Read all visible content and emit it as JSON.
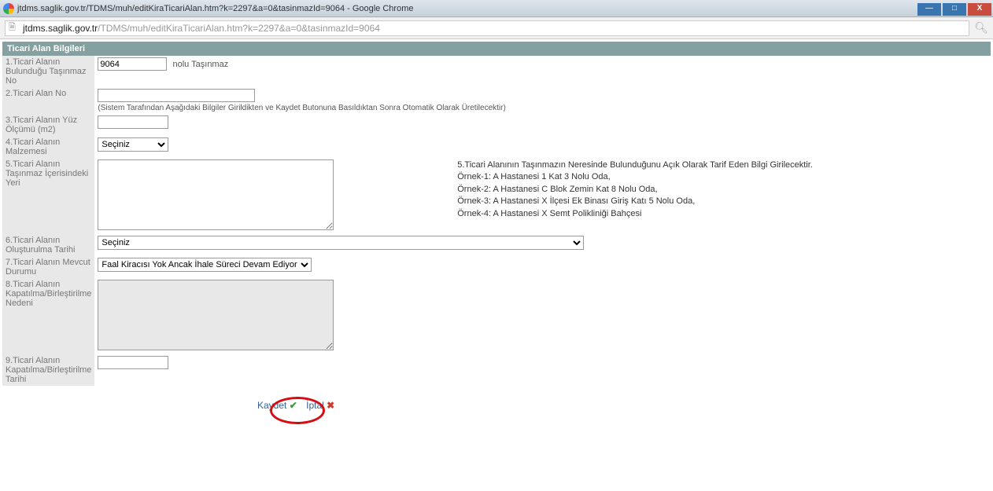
{
  "window": {
    "title": "jtdms.saglik.gov.tr/TDMS/muh/editKiraTicariAlan.htm?k=2297&a=0&tasinmazId=9064 - Google Chrome"
  },
  "url": {
    "domain": "jtdms.saglik.gov.tr",
    "path": "/TDMS/muh/editKiraTicariAlan.htm?k=2297&a=0&tasinmazId=9064"
  },
  "section_header": "Ticari Alan Bilgileri",
  "labels": {
    "r1": "1.Ticari Alanın Bulunduğu Taşınmaz No",
    "r2": "2.Ticari Alan No",
    "r3": "3.Ticari Alanın Yüz Ölçümü (m2)",
    "r4": "4.Ticari Alanın Malzemesi",
    "r5": "5.Ticari Alanın Taşınmaz İçerisindeki Yeri",
    "r6": "6.Ticari Alanın Oluşturulma Tarihi",
    "r7": "7.Ticari Alanın Mevcut Durumu",
    "r8": "8.Ticari Alanın Kapatılma/Birleştirilme Nedeni",
    "r9": "9.Ticari Alanın Kapatılma/Birleştirilme Tarihi"
  },
  "values": {
    "tasinmaz_no": "9064",
    "tasinmaz_suffix": "nolu Taşınmaz",
    "ticari_alan_no": "",
    "ticari_alan_hint": "(Sistem Tarafından Aşağıdaki Bilgiler Girildikten ve Kaydet Butonuna Basıldıktan Sonra Otomatik Olarak Üretilecektir)",
    "yuzolcum": "",
    "malzeme_selected": "Seçiniz",
    "yeri_text": "",
    "olusturma_selected": "Seçiniz",
    "mevcut_durum_selected": "Faal Kiracısı Yok Ancak İhale Süreci Devam Ediyor",
    "kapatma_nedeni": "",
    "kapatma_tarihi": ""
  },
  "info_block": {
    "line1": "5.Ticari Alanının Taşınmazın Neresinde Bulunduğunu Açık Olarak Tarif Eden Bilgi Girilecektir.",
    "line2": "Örnek-1: A Hastanesi 1 Kat 3 Nolu Oda,",
    "line3": "Örnek-2: A Hastanesi C Blok Zemin Kat 8 Nolu Oda,",
    "line4": "Örnek-3: A Hastanesi X İlçesi Ek Binası Giriş Katı 5 Nolu Oda,",
    "line5": "Örnek-4: A Hastanesi X Semt Polikliniği Bahçesi"
  },
  "buttons": {
    "save": "Kaydet",
    "cancel": "İptal"
  }
}
